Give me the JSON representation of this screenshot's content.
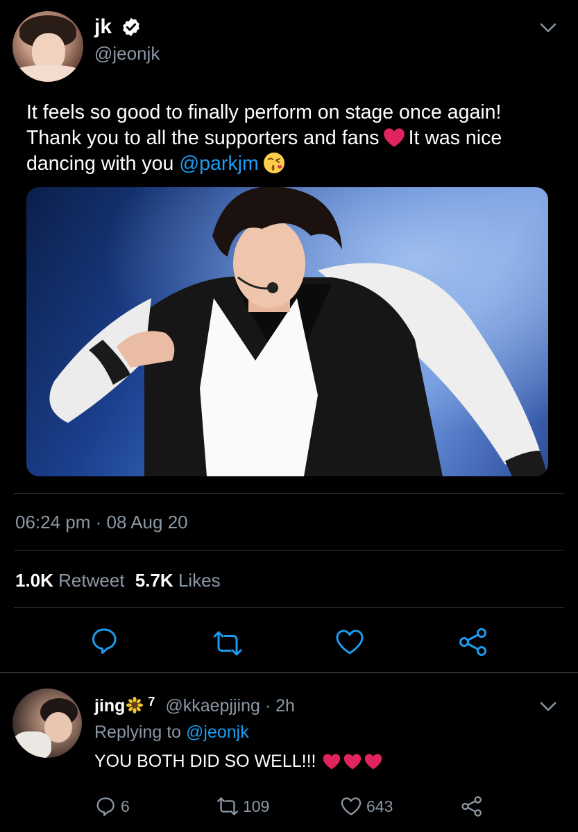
{
  "tweet": {
    "display_name": "jk",
    "handle": "@jeonjk",
    "text_part1": "It feels so good to finally perform on stage once again! Thank you to all the supporters and fans",
    "text_part2": "It was nice dancing with you",
    "mention": "@parkjm",
    "timestamp": "06:24 pm · 08 Aug 20",
    "retweets_count": "1.0K",
    "retweets_label": "Retweet",
    "likes_count": "5.7K",
    "likes_label": "Likes",
    "icons": [
      "verified-icon",
      "heart-emoji",
      "kiss-emoji",
      "reply-icon",
      "retweet-icon",
      "like-icon",
      "share-icon",
      "chevron-down-icon"
    ]
  },
  "reply": {
    "display_name": "jing",
    "badge": "7",
    "handle_time": "@kkaepjjing · 2h",
    "replying_label": "Replying to",
    "replying_to": "@jeonjk",
    "text": "YOU BOTH DID SO WELL!!!",
    "reply_count": "6",
    "retweet_count": "109",
    "like_count": "643"
  },
  "colors": {
    "background": "#000000",
    "accent": "#1d9bf0",
    "secondary_text": "#8b98a5",
    "divider": "#2f3336",
    "heart": "#e0245e"
  }
}
